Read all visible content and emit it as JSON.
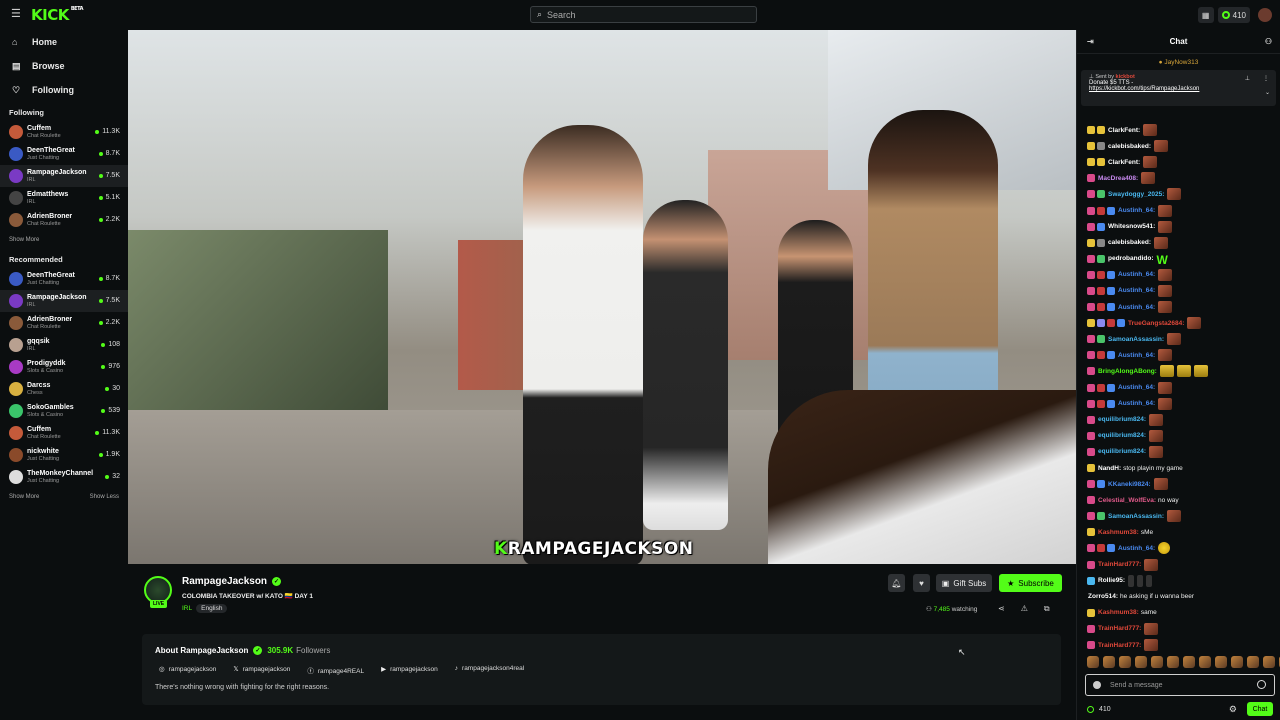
{
  "app": {
    "logo": "KICK",
    "beta": "BETA"
  },
  "search": {
    "placeholder": "Search"
  },
  "topbar": {
    "points": "410"
  },
  "nav": [
    {
      "label": "Home",
      "icon": "home-icon"
    },
    {
      "label": "Browse",
      "icon": "browse-icon"
    },
    {
      "label": "Following",
      "icon": "heart-icon"
    }
  ],
  "following": {
    "title": "Following",
    "channels": [
      {
        "name": "Cuffem",
        "category": "Chat Roulette",
        "viewers": "11.3K",
        "color": "#c45a3a"
      },
      {
        "name": "DeenTheGreat",
        "category": "Just Chatting",
        "viewers": "8.7K",
        "color": "#3a5ac4"
      },
      {
        "name": "RampageJackson",
        "category": "IRL",
        "viewers": "7.5K",
        "color": "#7a3ac4"
      },
      {
        "name": "Edmatthews",
        "category": "IRL",
        "viewers": "5.1K",
        "color": "#444444"
      },
      {
        "name": "AdrienBroner",
        "category": "Chat Roulette",
        "viewers": "2.2K",
        "color": "#8a5a3a"
      }
    ],
    "show_more": "Show More"
  },
  "recommended": {
    "title": "Recommended",
    "channels": [
      {
        "name": "DeenTheGreat",
        "category": "Just Chatting",
        "viewers": "8.7K",
        "color": "#3a5ac4"
      },
      {
        "name": "RampageJackson",
        "category": "IRL",
        "viewers": "7.5K",
        "color": "#7a3ac4"
      },
      {
        "name": "AdrienBroner",
        "category": "Chat Roulette",
        "viewers": "2.2K",
        "color": "#8a5a3a"
      },
      {
        "name": "gqqsik",
        "category": "IRL",
        "viewers": "108",
        "color": "#b8a090"
      },
      {
        "name": "Prodigyddk",
        "category": "Slots & Casino",
        "viewers": "976",
        "color": "#a83ac4"
      },
      {
        "name": "Darcss",
        "category": "Chess",
        "viewers": "30",
        "color": "#d8b040"
      },
      {
        "name": "SokoGambles",
        "category": "Slots & Casino",
        "viewers": "539",
        "color": "#3ac46a"
      },
      {
        "name": "Cuffem",
        "category": "Chat Roulette",
        "viewers": "11.3K",
        "color": "#c45a3a"
      },
      {
        "name": "nickwhite",
        "category": "Just Chatting",
        "viewers": "1.9K",
        "color": "#8a4a2a"
      },
      {
        "name": "TheMonkeyChannel",
        "category": "Just Chatting",
        "viewers": "32",
        "color": "#dddddd"
      }
    ],
    "show_more": "Show More",
    "show_less": "Show Less"
  },
  "video": {
    "caption_k": "K",
    "caption_rest": "RAMPAGEJACKSON"
  },
  "stream": {
    "channel": "RampageJackson",
    "live_label": "LIVE",
    "title": "COLOMBIA TAKEOVER w/ KATO 🇨🇴 DAY 1",
    "category": "IRL",
    "language": "English",
    "viewers": "7,485",
    "watching_label": "watching",
    "gift_subs": "Gift Subs",
    "subscribe": "Subscribe"
  },
  "about": {
    "title": "About RampageJackson",
    "followers": "305.9K",
    "followers_label": "Followers",
    "socials": [
      {
        "icon": "◎",
        "handle": "rampagejackson"
      },
      {
        "icon": "𝕏",
        "handle": "rampagejackson"
      },
      {
        "icon": "ⓕ",
        "handle": "rampage4REAL"
      },
      {
        "icon": "▶",
        "handle": "rampagejackson"
      },
      {
        "icon": "♪",
        "handle": "rampagejackson4real"
      }
    ],
    "bio": "There's nothing wrong with fighting for the right reasons."
  },
  "chat": {
    "title": "Chat",
    "pinned_top": "JayNow313",
    "pinned": {
      "sent_by": "Sent by",
      "sender": "kickbot",
      "text": "Donate $5 TTS -",
      "link": "https://kickbot.com/tips/RampageJackson"
    },
    "messages": [
      {
        "user": "ClarkFent:",
        "color": "#ffffff",
        "badges": [
          "#e6c23a",
          "#e6c23a"
        ],
        "text": "",
        "emote": "e"
      },
      {
        "user": "calebisbaked:",
        "color": "#ffffff",
        "badges": [
          "#e6c23a",
          "#888888"
        ],
        "text": "",
        "emote": "e"
      },
      {
        "user": "ClarkFent:",
        "color": "#ffffff",
        "badges": [
          "#e6c23a",
          "#e6c23a"
        ],
        "text": "",
        "emote": "e"
      },
      {
        "user": "MacDrea408:",
        "color": "#c98af0",
        "badges": [
          "#d94a8a"
        ],
        "text": "",
        "emote": "e"
      },
      {
        "user": "Swaydoggy_2025:",
        "color": "#4ab8f0",
        "badges": [
          "#d94a8a",
          "#4ac46a"
        ],
        "text": "",
        "emote": "e"
      },
      {
        "user": "Austinh_64:",
        "color": "#4a8af0",
        "badges": [
          "#d94a8a",
          "#c43a3a",
          "#4a8af0"
        ],
        "text": "",
        "emote": "e"
      },
      {
        "user": "Whitesnow541:",
        "color": "#ffffff",
        "badges": [
          "#d94a8a",
          "#4a8af0"
        ],
        "text": "",
        "emote": "e"
      },
      {
        "user": "calebisbaked:",
        "color": "#ffffff",
        "badges": [
          "#e6c23a",
          "#888888"
        ],
        "text": "",
        "emote": "e"
      },
      {
        "user": "pedrobandido:",
        "color": "#ffffff",
        "badges": [
          "#d94a8a",
          "#4ac46a"
        ],
        "text": "",
        "emote": "w"
      },
      {
        "user": "Austinh_64:",
        "color": "#4a8af0",
        "badges": [
          "#d94a8a",
          "#c43a3a",
          "#4a8af0"
        ],
        "text": "",
        "emote": "e"
      },
      {
        "user": "Austinh_64:",
        "color": "#4a8af0",
        "badges": [
          "#d94a8a",
          "#c43a3a",
          "#4a8af0"
        ],
        "text": "",
        "emote": "e"
      },
      {
        "user": "Austinh_64:",
        "color": "#4a8af0",
        "badges": [
          "#d94a8a",
          "#c43a3a",
          "#4a8af0"
        ],
        "text": "",
        "emote": "e"
      },
      {
        "user": "TrueGangsta2684:",
        "color": "#e0483a",
        "badges": [
          "#e6c23a",
          "#8a8af0",
          "#c43a3a",
          "#4a8af0"
        ],
        "text": "",
        "emote": "e"
      },
      {
        "user": "SamoanAssassin:",
        "color": "#4ab8f0",
        "badges": [
          "#d94a8a",
          "#4ac46a"
        ],
        "text": "",
        "emote": "e"
      },
      {
        "user": "Austinh_64:",
        "color": "#4a8af0",
        "badges": [
          "#d94a8a",
          "#c43a3a",
          "#4a8af0"
        ],
        "text": "",
        "emote": "e"
      },
      {
        "user": "BringAlongABong:",
        "color": "#53fc18",
        "badges": [
          "#d94a8a"
        ],
        "text": "",
        "emote": "g"
      },
      {
        "user": "Austinh_64:",
        "color": "#4a8af0",
        "badges": [
          "#d94a8a",
          "#c43a3a",
          "#4a8af0"
        ],
        "text": "",
        "emote": "e"
      },
      {
        "user": "Austinh_64:",
        "color": "#4a8af0",
        "badges": [
          "#d94a8a",
          "#c43a3a",
          "#4a8af0"
        ],
        "text": "",
        "emote": "e"
      },
      {
        "user": "equilibrium824:",
        "color": "#4ab8f0",
        "badges": [
          "#d94a8a"
        ],
        "text": "",
        "emote": "e"
      },
      {
        "user": "equilibrium824:",
        "color": "#4ab8f0",
        "badges": [
          "#d94a8a"
        ],
        "text": "",
        "emote": "e"
      },
      {
        "user": "equilibrium824:",
        "color": "#4ab8f0",
        "badges": [
          "#d94a8a"
        ],
        "text": "",
        "emote": "e"
      },
      {
        "user": "NandH:",
        "color": "#ffffff",
        "badges": [
          "#e6c23a"
        ],
        "text": "stop playin my game",
        "emote": ""
      },
      {
        "user": "KKaneki9824:",
        "color": "#4a8af0",
        "badges": [
          "#d94a8a",
          "#4a8af0"
        ],
        "text": "",
        "emote": "e"
      },
      {
        "user": "Celestial_WolfEva:",
        "color": "#e05a8a",
        "badges": [
          "#d94a8a"
        ],
        "text": "no way",
        "emote": ""
      },
      {
        "user": "SamoanAssassin:",
        "color": "#4ab8f0",
        "badges": [
          "#d94a8a",
          "#4ac46a"
        ],
        "text": "",
        "emote": "e"
      },
      {
        "user": "Kashmum38:",
        "color": "#e0483a",
        "badges": [
          "#e6c23a"
        ],
        "text": "sMe",
        "emote": ""
      },
      {
        "user": "Austinh_64:",
        "color": "#4a8af0",
        "badges": [
          "#d94a8a",
          "#c43a3a",
          "#4a8af0"
        ],
        "text": "",
        "emote": "y"
      },
      {
        "user": "TrainHard777:",
        "color": "#e0483a",
        "badges": [
          "#d94a8a"
        ],
        "text": "",
        "emote": "e"
      },
      {
        "user": "Rollie95:",
        "color": "#ffffff",
        "badges": [
          "#4ab8f0"
        ],
        "text": "",
        "emote": "d"
      },
      {
        "user": "Zorro514:",
        "color": "#ffffff",
        "badges": [],
        "text": "he asking if u wanna beer",
        "emote": ""
      },
      {
        "user": "Kashmum38:",
        "color": "#e0483a",
        "badges": [
          "#e6c23a"
        ],
        "text": "same",
        "emote": ""
      },
      {
        "user": "TrainHard777:",
        "color": "#e0483a",
        "badges": [
          "#d94a8a"
        ],
        "text": "",
        "emote": "e"
      },
      {
        "user": "TrainHard777:",
        "color": "#e0483a",
        "badges": [
          "#d94a8a"
        ],
        "text": "",
        "emote": "e"
      }
    ],
    "input_placeholder": "Send a message",
    "points": "410",
    "send": "Chat"
  },
  "colors": {
    "accent": "#53fc18",
    "bg": "#0b0e0f"
  }
}
